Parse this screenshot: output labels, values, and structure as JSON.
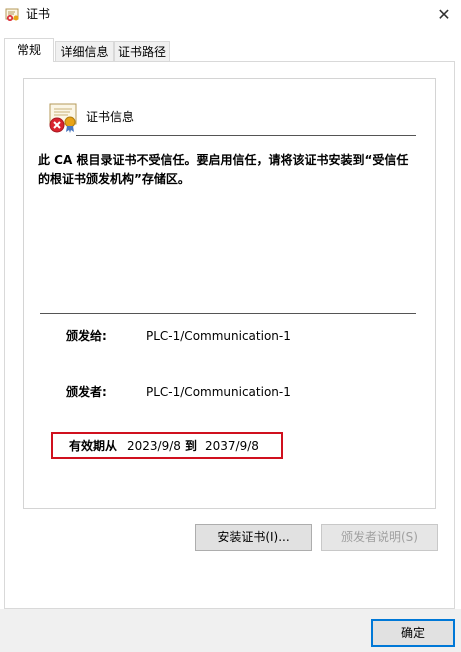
{
  "window": {
    "title": "证书",
    "close_glyph": "✕"
  },
  "tabs": [
    {
      "label": "常规",
      "active": true
    },
    {
      "label": "详细信息",
      "active": false
    },
    {
      "label": "证书路径",
      "active": false
    }
  ],
  "cert_info": {
    "heading": "证书信息",
    "warning_text": "此 CA 根目录证书不受信任。要启用信任，请将该证书安装到“受信任的根证书颁发机构”存储区。",
    "issued_to_label": "颁发给:",
    "issued_to_value": "PLC-1/Communication-1",
    "issued_by_label": "颁发者:",
    "issued_by_value": "PLC-1/Communication-1",
    "valid_from_label": "有效期从",
    "valid_from": "2023/9/8",
    "valid_to_label": "到",
    "valid_to": "2037/9/8"
  },
  "buttons": {
    "install": "安装证书(I)...",
    "issuer_statement": "颁发者说明(S)",
    "ok": "确定"
  },
  "colors": {
    "highlight_border": "#d0101e",
    "ok_border": "#0078d7",
    "error_icon": "#d9232e"
  },
  "icons": {
    "title": "certificate-icon",
    "cert_error": "certificate-error-icon",
    "close": "close-icon"
  }
}
